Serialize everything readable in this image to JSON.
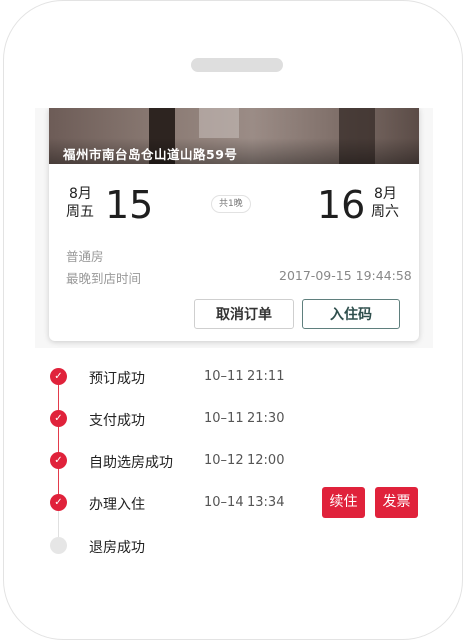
{
  "hotel": {
    "address": "福州市南台岛仓山道山路59号"
  },
  "stay": {
    "checkin_month": "8月",
    "checkin_weekday": "周五",
    "checkin_day": "15",
    "nights": "共1晚",
    "checkout_day": "16",
    "checkout_month": "8月",
    "checkout_weekday": "周六",
    "room_type": "普通房",
    "latest_arrival_label": "最晚到店时间",
    "latest_arrival_value": "2017-09-15 19:44:58"
  },
  "actions": {
    "cancel_label": "取消订单",
    "checkin_code_label": "入住码"
  },
  "timeline": [
    {
      "label": "预订成功",
      "date": "10–11",
      "time": "21:11",
      "done": true
    },
    {
      "label": "支付成功",
      "date": "10–11",
      "time": "21:30",
      "done": true
    },
    {
      "label": "自助选房成功",
      "date": "10–12",
      "time": "12:00",
      "done": true
    },
    {
      "label": "办理入住",
      "date": "10–14",
      "time": "13:34",
      "done": true
    },
    {
      "label": "退房成功",
      "date": "",
      "time": "",
      "done": false
    }
  ],
  "row_actions": {
    "extend_label": "续住",
    "invoice_label": "发票"
  },
  "colors": {
    "accent": "#e0223b",
    "checkin_border": "#5f7f7d"
  },
  "icons": {
    "done": "check-icon"
  }
}
